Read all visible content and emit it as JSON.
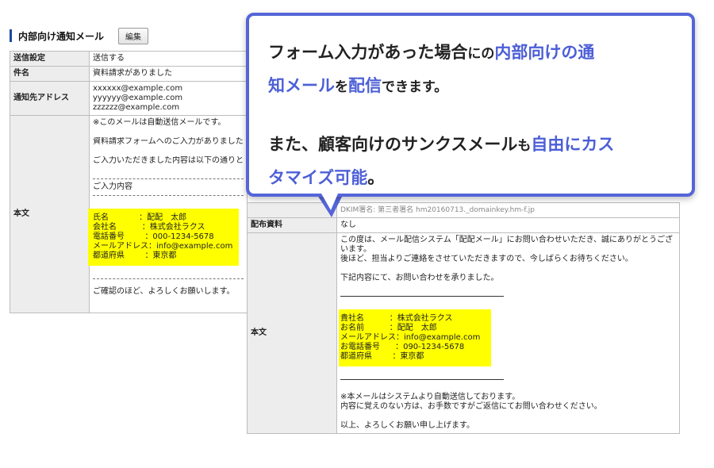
{
  "left": {
    "header": {
      "title": "内部向け通知メール",
      "edit_label": "編集"
    },
    "rows": {
      "send": {
        "label": "送信設定",
        "value": "送信する"
      },
      "subject": {
        "label": "件名",
        "value": "資料請求がありました"
      },
      "recipients": {
        "label": "通知先アドレス",
        "values": [
          "xxxxxx@example.com",
          "yyyyyy@example.com",
          "zzzzzz@example.com"
        ]
      },
      "body": {
        "label": "本文",
        "line1": "※このメールは自動送信メールです。",
        "line2": "資料請求フォームへのご入力がありました",
        "line3": "ご入力いただきました内容は以下の通りと",
        "section": "ご入力内容",
        "fields": [
          {
            "k": "氏名            ",
            "v": "：配配　太郎"
          },
          {
            "k": "会社名          ",
            "v": "：株式会社ラクス"
          },
          {
            "k": "電話番号        ",
            "v": "：000-1234-5678"
          },
          {
            "k": "メールアドレス",
            "v": "：info@example.com"
          },
          {
            "k": "都道府県        ",
            "v": "：東京都"
          }
        ],
        "closing": "ご確認のほど、よろしくお願いします。"
      }
    }
  },
  "right": {
    "dkim": "DKIM署名: 第三者署名 hm20160713._domainkey.hm-f.jp",
    "rows": {
      "dist": {
        "label": "配布資料",
        "value": "なし"
      },
      "body": {
        "label": "本文",
        "p1": "この度は、メール配信システム「配配メール」にお問い合わせいただき、誠にありがとうございます。",
        "p2": "後ほど、担当よりご連絡をさせていただきますので、今しばらくお待ちください。",
        "p3": "下記内容にて、お問い合わせを承りました。",
        "fields": [
          {
            "k": "貴社名          ",
            "v": "：株式会社ラクス"
          },
          {
            "k": "お名前          ",
            "v": "：配配　太郎"
          },
          {
            "k": "メールアドレス",
            "v": "：info@example.com"
          },
          {
            "k": "お電話番号      ",
            "v": "：090-1234-5678"
          },
          {
            "k": "都道府県        ",
            "v": "：東京都"
          }
        ],
        "p4": "※本メールはシステムより自動送信しております。",
        "p5": "内容に覚えのない方は、お手数ですがご返信にてお問い合わせください。",
        "p6": "以上、よろしくお願い申し上げます。"
      }
    }
  },
  "callout": {
    "l1a": "フォーム入力があった場合",
    "l1b": "にの",
    "l1c": "内部向けの通",
    "l2a": "知メール",
    "l2b": "を",
    "l2c": "配信",
    "l2d": "できます。",
    "l3a": "また、顧客向けのサンクスメール",
    "l3b": "も",
    "l3c": "自由にカス",
    "l4a": "タマイズ可能",
    "l4b": "。"
  },
  "colors": {
    "accent": "#5565d8",
    "highlight": "#ffff00",
    "header_bar": "#1a4a9c"
  }
}
